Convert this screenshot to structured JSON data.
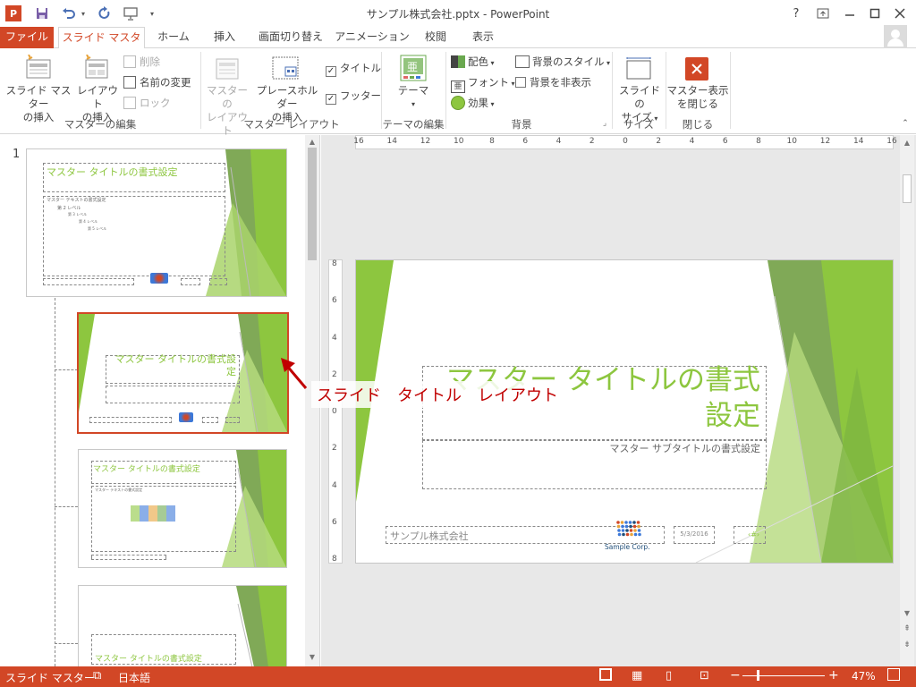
{
  "window": {
    "title": "サンプル株式会社.pptx - PowerPoint",
    "help": "?"
  },
  "tabs": [
    "ファイル",
    "スライド マスター",
    "ホーム",
    "挿入",
    "画面切り替え",
    "アニメーション",
    "校閲",
    "表示"
  ],
  "ribbon": {
    "edit_master": {
      "insert_master": [
        "スライド マスター",
        "の挿入"
      ],
      "insert_layout": [
        "レイアウト",
        "の挿入"
      ],
      "delete": "削除",
      "rename": "名前の変更",
      "lock": "ロック",
      "group": "マスターの編集"
    },
    "master_layout": {
      "master_layout_btn": [
        "マスターの",
        "レイアウト"
      ],
      "insert_placeholder": [
        "プレースホルダー",
        "の挿入"
      ],
      "title_check": "タイトル",
      "footer_check": "フッター",
      "group": "マスター レイアウト"
    },
    "edit_theme": {
      "theme": "テーマ",
      "group": "テーマの編集"
    },
    "background": {
      "colors": "配色",
      "fonts": "フォント",
      "effects": "効果",
      "bg_styles": "背景のスタイル",
      "hide_bg": "背景を非表示",
      "group": "背景"
    },
    "size": {
      "slide_size": [
        "スライドの",
        "サイズ"
      ],
      "group": "サイズ"
    },
    "close": {
      "close_master": [
        "マスター表示",
        "を閉じる"
      ],
      "group": "閉じる"
    }
  },
  "thumbs": {
    "number": "1",
    "master_title": "マスター タイトルの書式設定",
    "master_text": "マスター テキストの書式設定",
    "level2": "第 2 レベル",
    "level3": "第 3 レベル",
    "level4": "第 4 レベル",
    "level5": "第 5 レベル",
    "title_layout_title": "マスター タイトルの書式設定",
    "sample_corp": "Sample Corp."
  },
  "callout": "スライド　タイトル　レイアウト",
  "ruler": {
    "h": [
      "16",
      "14",
      "12",
      "10",
      "8",
      "6",
      "4",
      "2",
      "0",
      "2",
      "4",
      "6",
      "8",
      "10",
      "12",
      "14",
      "16"
    ],
    "v": [
      "8",
      "6",
      "4",
      "2",
      "0",
      "2",
      "4",
      "6",
      "8"
    ]
  },
  "slide": {
    "title": "マスター タイトルの書式設定",
    "subtitle": "マスター サブタイトルの書式設定",
    "footer": "サンプル株式会社",
    "date": "5/3/2016",
    "logo_text": "Sample Corp."
  },
  "status": {
    "view": "スライド マスター",
    "language": "日本語",
    "zoom": "47%"
  },
  "colors": {
    "accent": "#d24726",
    "green": "#8dc63f"
  }
}
